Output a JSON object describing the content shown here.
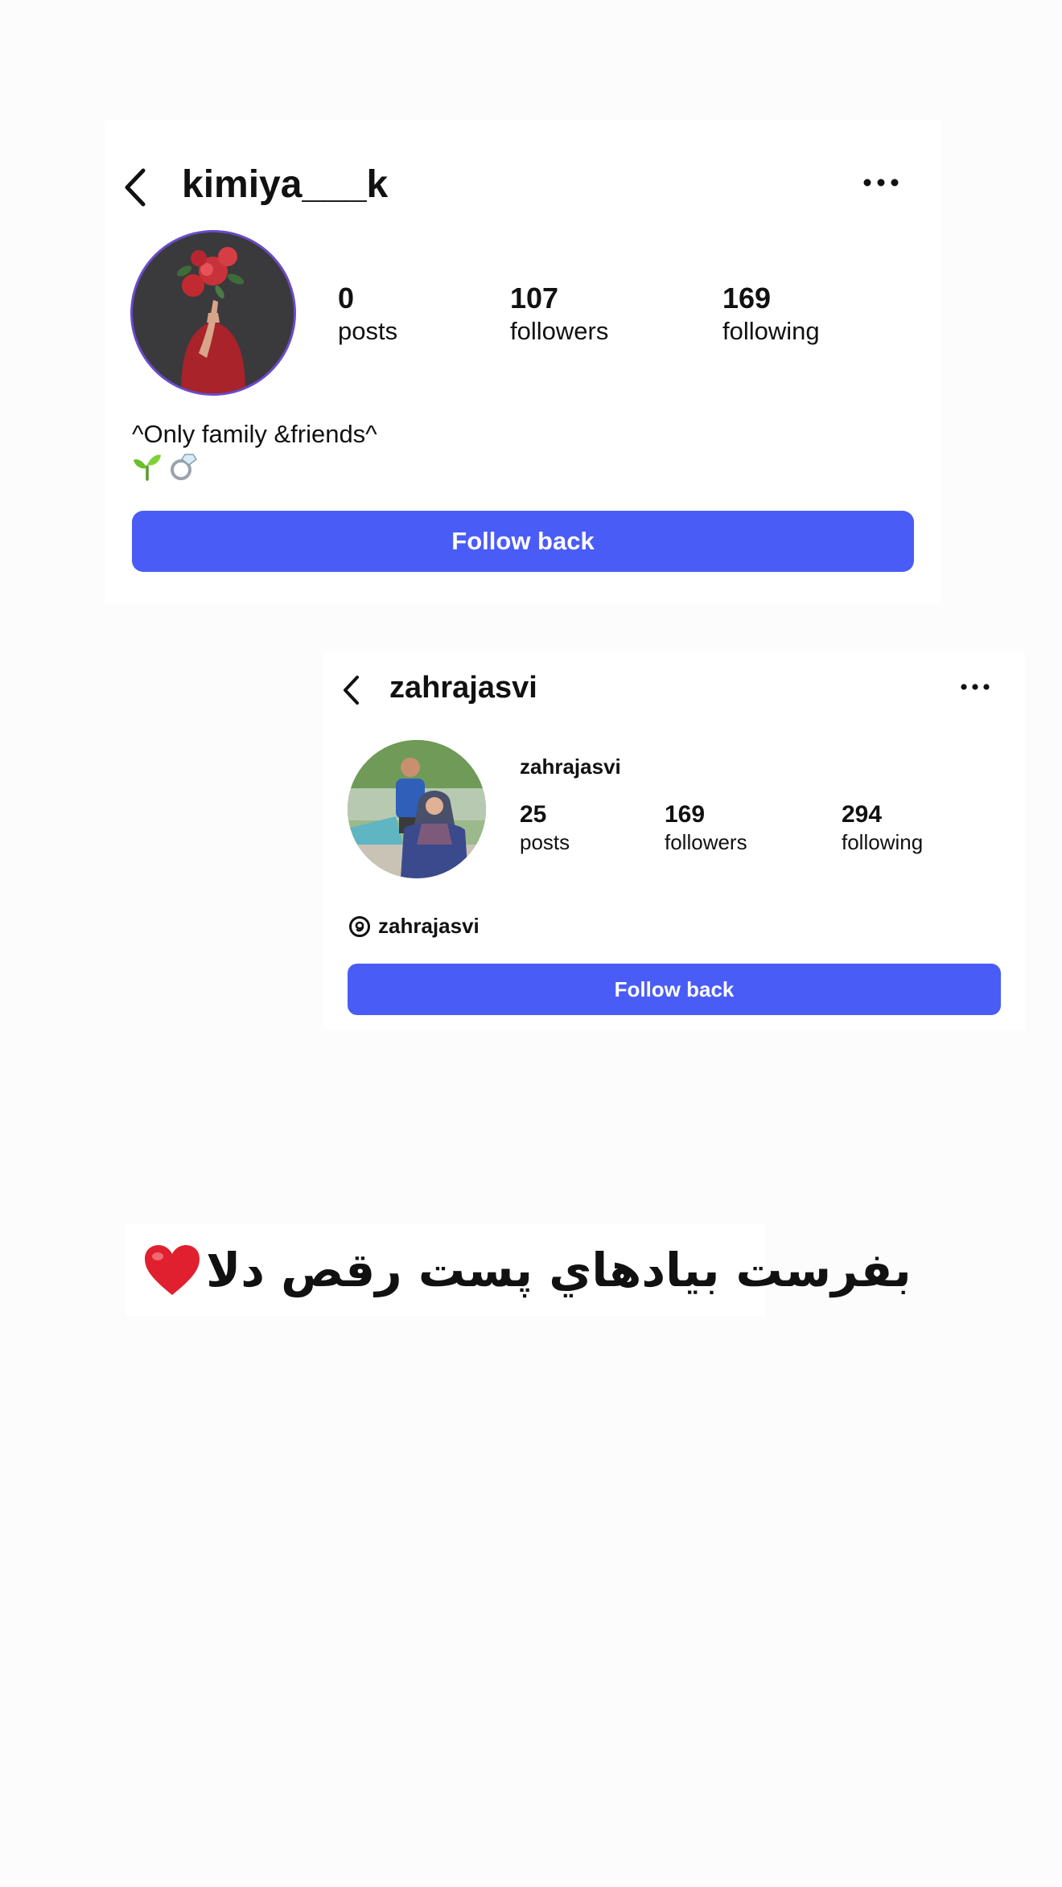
{
  "profile_card_1": {
    "username": "kimiya___k",
    "stats": [
      {
        "value": "0",
        "label": "posts"
      },
      {
        "value": "107",
        "label": "followers"
      },
      {
        "value": "169",
        "label": "following"
      }
    ],
    "bio": "^Only family &friends^",
    "bio_emojis": [
      "🌱",
      "💍"
    ],
    "follow_button": "Follow back",
    "icons": {
      "back": "chevron-left-icon",
      "more": "more-horizontal-icon"
    }
  },
  "profile_card_2": {
    "username": "zahrajasvi",
    "display_name": "zahrajasvi",
    "stats": [
      {
        "value": "25",
        "label": "posts"
      },
      {
        "value": "169",
        "label": "followers"
      },
      {
        "value": "294",
        "label": "following"
      }
    ],
    "threads_handle": "zahrajasvi",
    "follow_button": "Follow back",
    "icons": {
      "back": "chevron-left-icon",
      "more": "more-horizontal-icon",
      "threads": "threads-icon"
    }
  },
  "caption": {
    "text": "بفرست بيادهاي پست رقص دلا",
    "emoji": "heart-icon"
  },
  "colors": {
    "button_blue": "#4a5cf6",
    "background": "#fcfcfc",
    "card": "#ffffff",
    "heart_red": "#e0202e"
  }
}
